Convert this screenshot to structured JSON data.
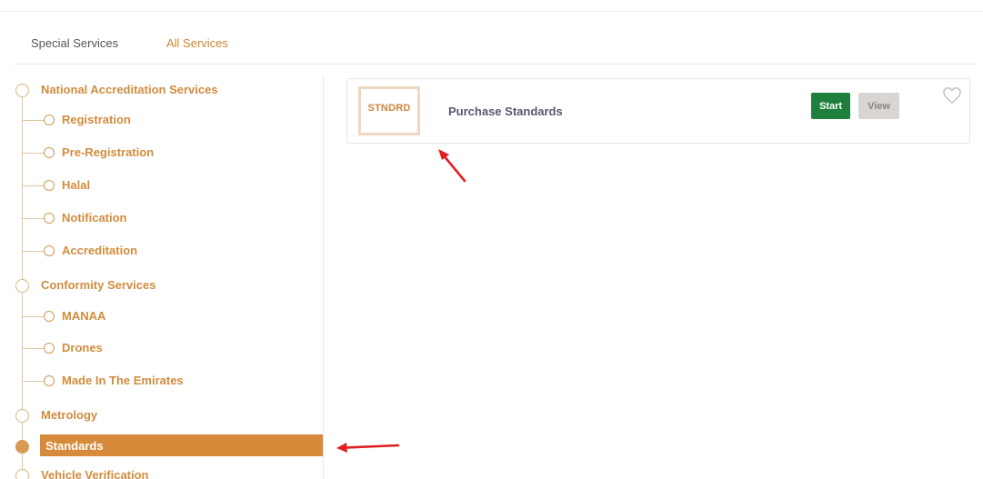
{
  "tabs": [
    {
      "label": "Special Services",
      "active": false
    },
    {
      "label": "All Services",
      "active": true
    }
  ],
  "sidebar": {
    "items": [
      {
        "type": "category",
        "label": "National Accreditation Services"
      },
      {
        "type": "sub",
        "label": "Registration"
      },
      {
        "type": "sub",
        "label": "Pre-Registration"
      },
      {
        "type": "sub",
        "label": "Halal"
      },
      {
        "type": "sub",
        "label": "Notification"
      },
      {
        "type": "sub",
        "label": "Accreditation"
      },
      {
        "type": "category",
        "label": "Conformity Services"
      },
      {
        "type": "sub",
        "label": "MANAA"
      },
      {
        "type": "sub",
        "label": "Drones"
      },
      {
        "type": "sub",
        "label": "Made In The Emirates"
      },
      {
        "type": "category",
        "label": "Metrology"
      },
      {
        "type": "category",
        "label": "Standards",
        "active": true
      },
      {
        "type": "category",
        "label": "Vehicle Verification"
      }
    ]
  },
  "service_card": {
    "logo_text": "STNDRD",
    "title": "Purchase Standards",
    "start_label": "Start",
    "view_label": "View"
  },
  "colors": {
    "accent": "#d78a3a",
    "start_green": "#1e7f3c",
    "view_gray": "#d8d5d2",
    "annotation_red": "#e02020"
  }
}
